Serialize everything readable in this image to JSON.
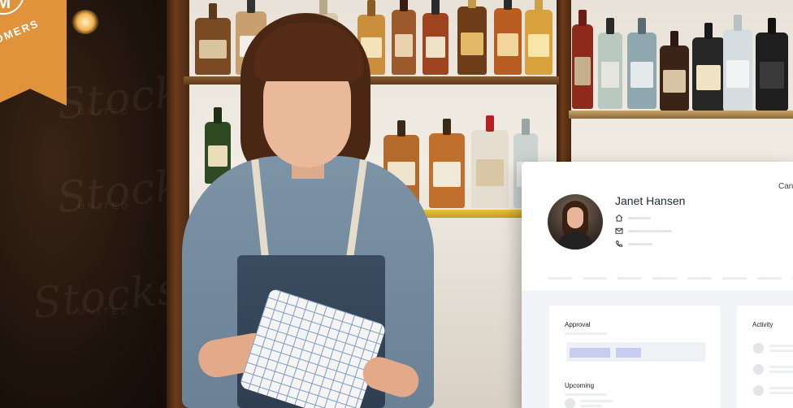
{
  "badge": {
    "text": "OMERS",
    "logo_letter": "M"
  },
  "watermark": {
    "script": "Stocks",
    "sub": "UNITED"
  },
  "profile": {
    "name": "Janet Hansen",
    "cancel_label": "Can",
    "contacts": [
      {
        "icon": "home-icon"
      },
      {
        "icon": "mail-icon"
      },
      {
        "icon": "phone-icon"
      }
    ]
  },
  "panels": {
    "approval": {
      "title": "Approval"
    },
    "upcoming": {
      "title": "Upcoming"
    },
    "activity": {
      "title": "Activity"
    }
  },
  "colors": {
    "ribbon": "#e0933a",
    "approval_chip": "#c7cdf1",
    "card_bg": "#ffffff",
    "panel_area": "#f3f4f7"
  }
}
